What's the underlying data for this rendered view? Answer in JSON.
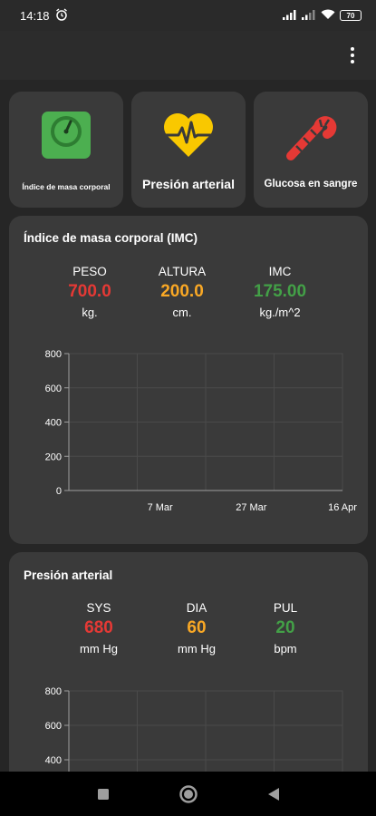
{
  "status_bar": {
    "time": "14:18",
    "battery": "70"
  },
  "tiles": [
    {
      "label": "Índice de masa corporal",
      "icon": "scale-icon"
    },
    {
      "label": "Presión arterial",
      "icon": "heart-pulse-icon"
    },
    {
      "label": "Glucosa en sangre",
      "icon": "candy-cane-icon"
    }
  ],
  "imc_card": {
    "title": "Índice de masa corporal (IMC)",
    "metrics": [
      {
        "label": "PESO",
        "value": "700.0",
        "unit": "kg.",
        "color": "#e53935"
      },
      {
        "label": "ALTURA",
        "value": "200.0",
        "unit": "cm.",
        "color": "#f9a825"
      },
      {
        "label": "IMC",
        "value": "175.00",
        "unit": "kg./m^2",
        "color": "#43a047"
      }
    ]
  },
  "bp_card": {
    "title": "Presión arterial",
    "metrics": [
      {
        "label": "SYS",
        "value": "680",
        "unit": "mm Hg",
        "color": "#e53935"
      },
      {
        "label": "DIA",
        "value": "60",
        "unit": "mm Hg",
        "color": "#f9a825"
      },
      {
        "label": "PUL",
        "value": "20",
        "unit": "bpm",
        "color": "#43a047"
      }
    ]
  },
  "chart_data": [
    {
      "type": "line",
      "title": "",
      "x_tick_labels": [
        "7 Mar",
        "27 Mar",
        "16 Apr"
      ],
      "y_tick_labels": [
        "0",
        "200",
        "400",
        "600",
        "800"
      ],
      "ylim": [
        0,
        800
      ],
      "grid": true,
      "series": []
    },
    {
      "type": "line",
      "title": "",
      "x_tick_labels": [],
      "y_tick_labels": [
        "400",
        "600",
        "800"
      ],
      "ylim": [
        0,
        800
      ],
      "grid": true,
      "series": []
    }
  ],
  "colors": {
    "background": "#262626",
    "card": "#3a3a3a",
    "accent_green": "#43a047",
    "accent_yellow": "#f9c800",
    "accent_red": "#e53935"
  }
}
